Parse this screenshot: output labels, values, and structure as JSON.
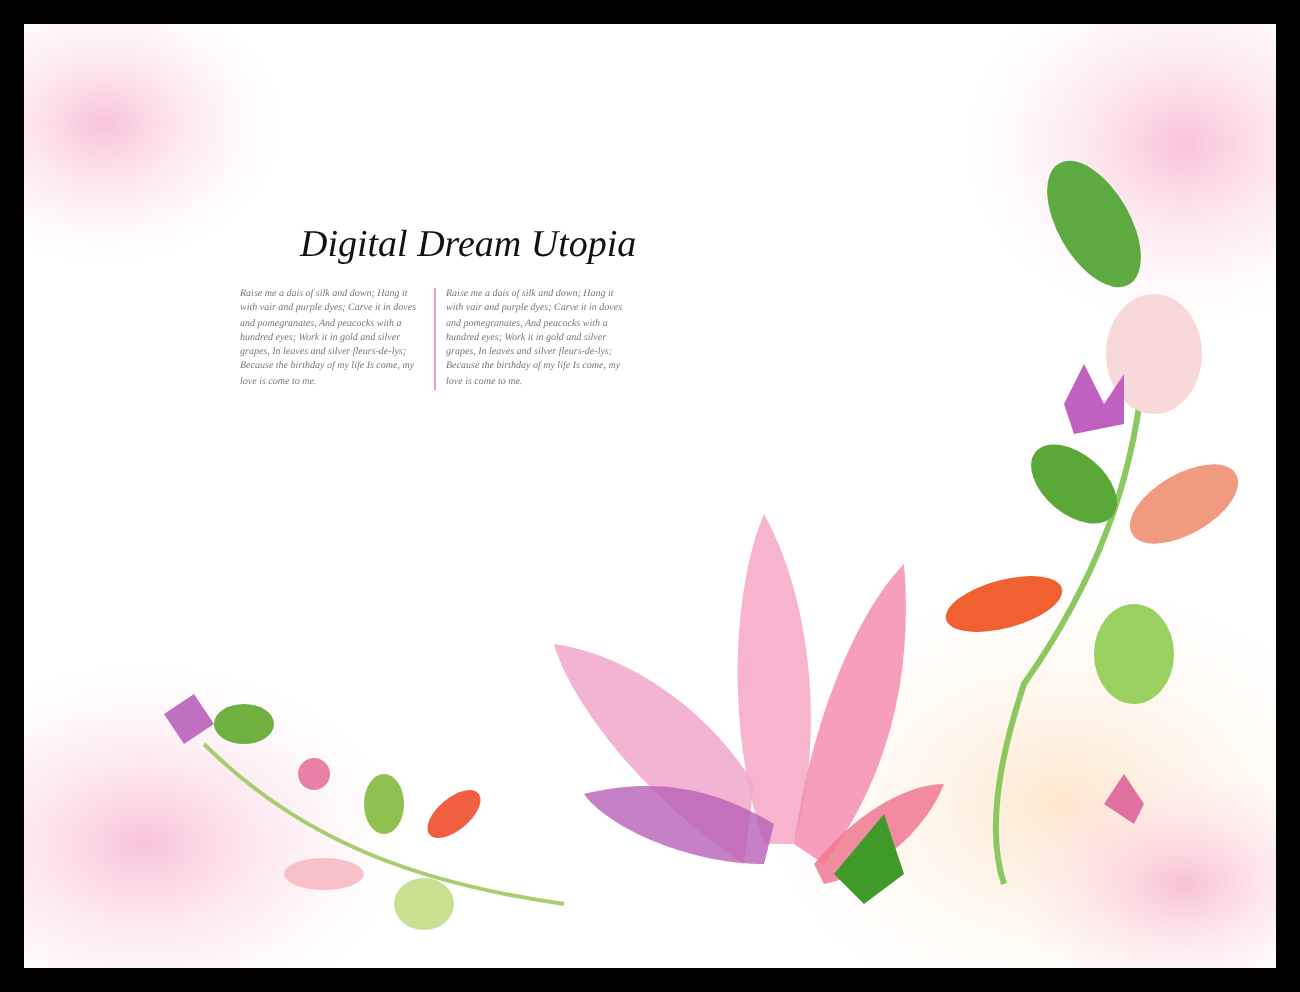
{
  "title": "Digital Dream Utopia",
  "columns": [
    {
      "text": "Raise me a dais of silk and down; Hang it with vair and purple dyes; Carve it in doves and pomegranates, And peacocks with a hundred eyes; Work it in gold and silver grapes, In leaves and silver fleurs-de-lys; Because the birthday of my life Is come, my love is come to me."
    },
    {
      "text": "Raise me a dais of silk and down; Hang it with vair and purple dyes; Carve it in doves and pomegranates, And peacocks with a hundred eyes; Work it in gold and silver grapes, In leaves and silver fleurs-de-lys; Because the birthday of my life Is come, my love is come to me."
    }
  ]
}
